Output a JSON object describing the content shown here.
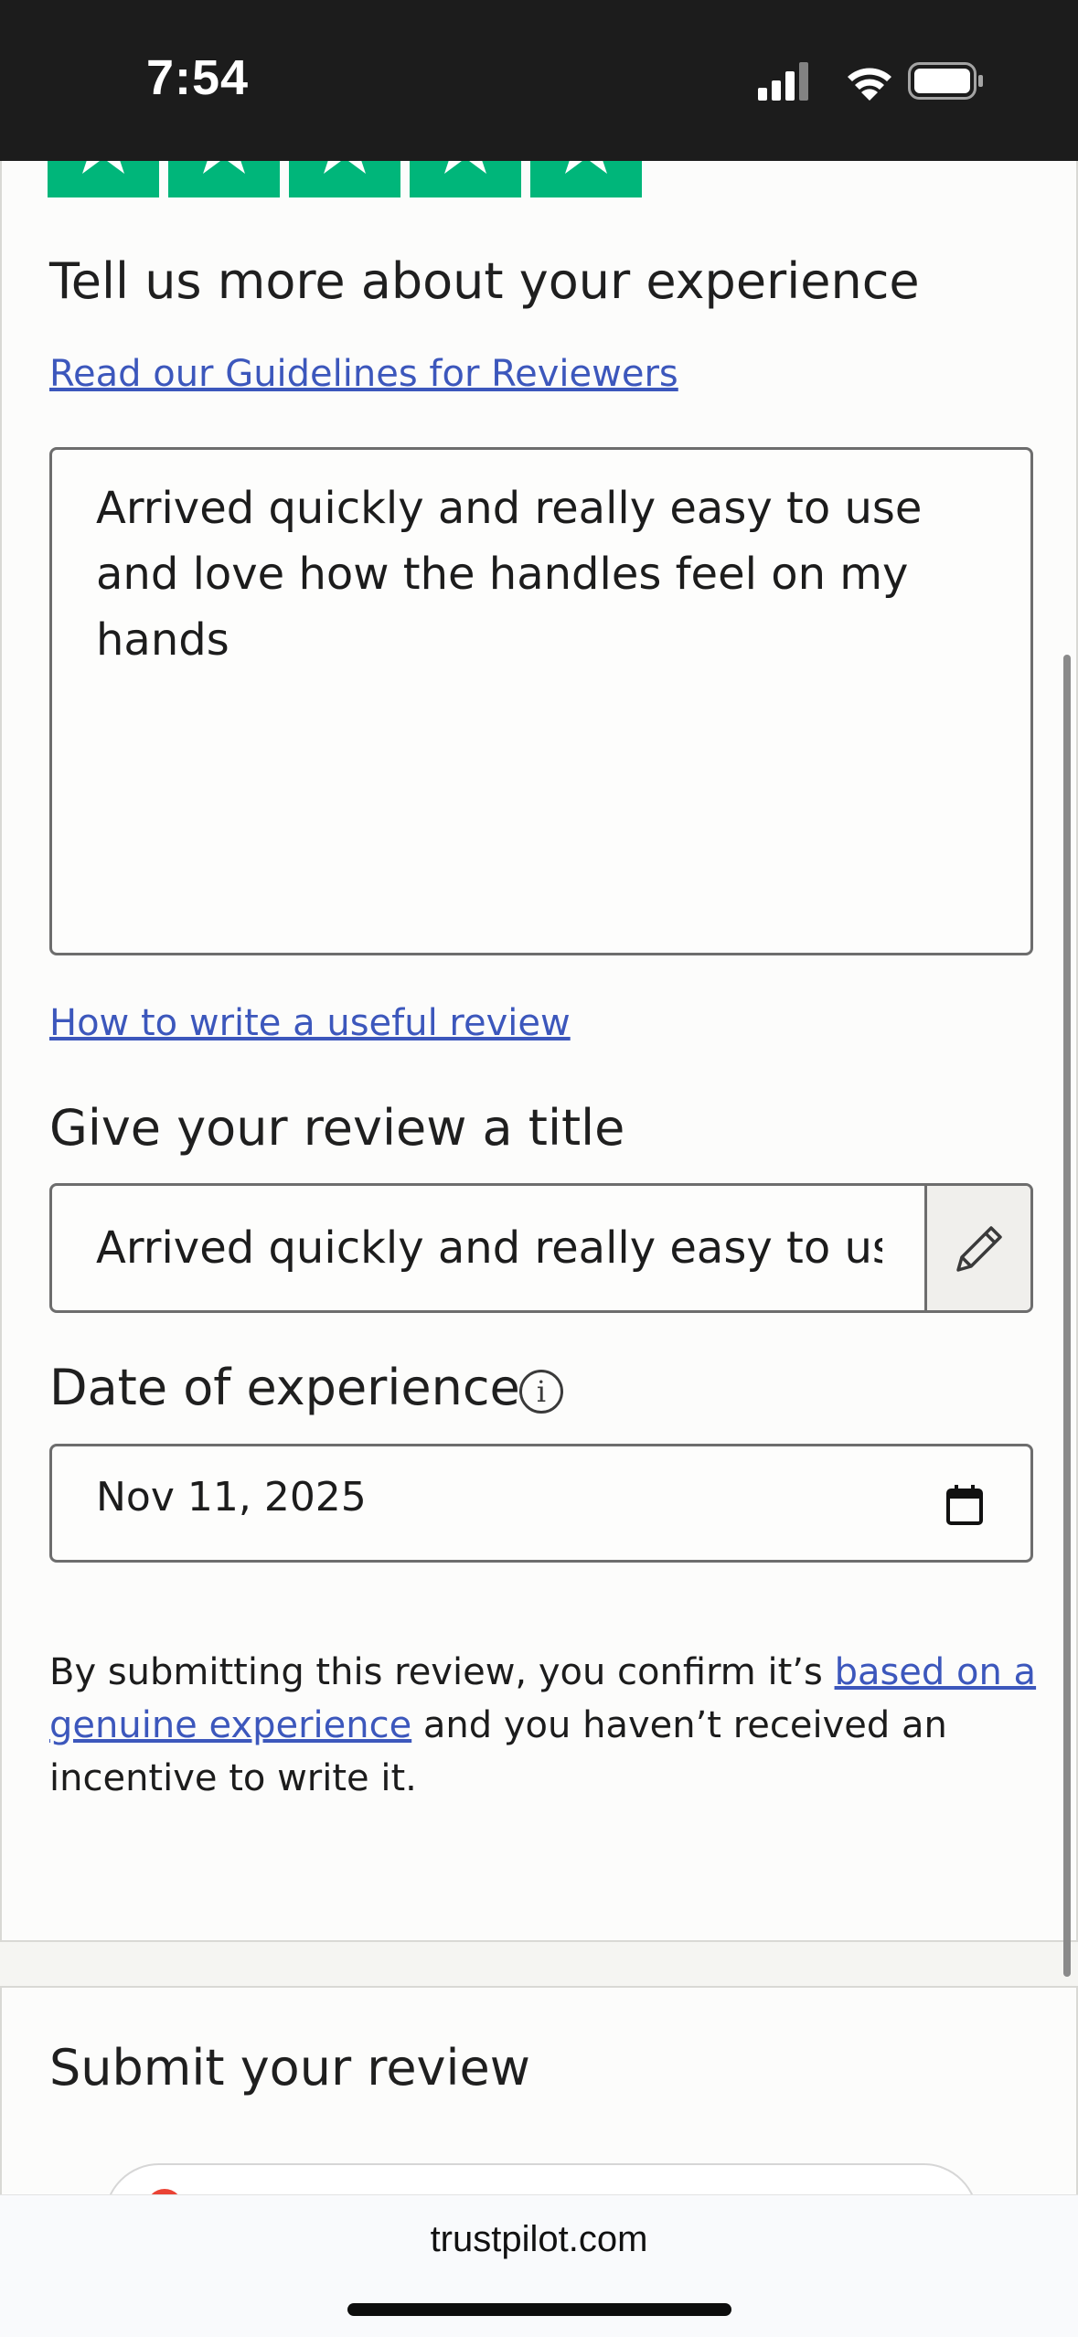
{
  "status_bar": {
    "time": "7:54"
  },
  "review": {
    "rating_stars": 5,
    "experience_heading": "Tell us more about your experience",
    "guidelines_link": "Read our Guidelines for Reviewers",
    "review_text": "Arrived quickly and really easy to use and love how the handles feel on my hands",
    "useful_review_link": "How to write a useful review",
    "title_heading": "Give your review a title",
    "title_value": "Arrived quickly and really easy to use",
    "date_heading": "Date of experience",
    "date_value": "Nov 11, 2025",
    "disclaimer": {
      "prefix": "By submitting this review, you confirm it’s ",
      "link": "based on a genuine experience",
      "suffix": " and you haven’t received an incentive to write it."
    }
  },
  "submit": {
    "heading": "Submit your review"
  },
  "browser": {
    "url": "trustpilot.com"
  },
  "colors": {
    "star_green": "#00b67a",
    "link_blue": "#3c57bc"
  },
  "icons": [
    "signal-icon",
    "wifi-icon",
    "battery-icon",
    "star-icon",
    "pencil-icon",
    "info-icon",
    "calendar-icon"
  ]
}
